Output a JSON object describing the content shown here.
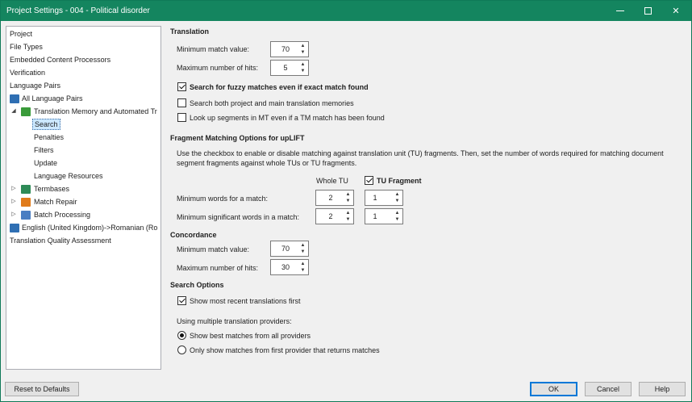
{
  "window": {
    "title": "Project Settings - 004 - Political disorder",
    "min_icon": "minimize-icon",
    "max_icon": "maximize-icon",
    "close_icon": "close-icon",
    "close_glyph": "✕"
  },
  "tree": {
    "project": "Project",
    "file_types": "File Types",
    "embedded": "Embedded Content Processors",
    "verification": "Verification",
    "language_pairs": "Language Pairs",
    "all_language_pairs": "All Language Pairs",
    "tm_automated": "Translation Memory and Automated Tr",
    "search": "Search",
    "penalties": "Penalties",
    "filters": "Filters",
    "update": "Update",
    "language_resources": "Language Resources",
    "termbases": "Termbases",
    "match_repair": "Match Repair",
    "batch_processing": "Batch Processing",
    "english_romanian": "English (United Kingdom)->Romanian (Ro",
    "tqa": "Translation Quality Assessment"
  },
  "translation": {
    "heading": "Translation",
    "min_match_label": "Minimum match value:",
    "min_match_value": "70",
    "max_hits_label": "Maximum number of hits:",
    "max_hits_value": "5",
    "fuzzy_label": "Search for fuzzy matches even if exact match found",
    "fuzzy_checked": true,
    "both_tms_label": "Search both project and main translation memories",
    "both_tms_checked": false,
    "mt_lookup_label": "Look up segments in MT even if a TM match has been found",
    "mt_lookup_checked": false
  },
  "fragment": {
    "heading": "Fragment Matching Options for upLIFT",
    "description": "Use the checkbox to enable or disable matching against translation unit (TU)  fragments. Then, set the number of words required for matching document segment fragments against whole TUs or TU fragments.",
    "whole_tu_header": "Whole TU",
    "tu_fragment_header": "TU Fragment",
    "tu_fragment_checked": true,
    "min_words_label": "Minimum words for a match:",
    "min_words_whole": "2",
    "min_words_fragment": "1",
    "min_sig_words_label": "Minimum significant words in a match:",
    "min_sig_whole": "2",
    "min_sig_fragment": "1"
  },
  "concordance": {
    "heading": "Concordance",
    "min_match_label": "Minimum match value:",
    "min_match_value": "70",
    "max_hits_label": "Maximum number of hits:",
    "max_hits_value": "30"
  },
  "search_options": {
    "heading": "Search Options",
    "recent_label": "Show most recent translations first",
    "recent_checked": true,
    "multi_label": "Using multiple translation providers:",
    "opt_best": "Show best matches from all providers",
    "opt_first": "Only show matches from first provider that returns matches",
    "selected": "best"
  },
  "buttons": {
    "reset": "Reset to Defaults",
    "ok": "OK",
    "cancel": "Cancel",
    "help": "Help"
  },
  "colors": {
    "titlebar": "#14855f",
    "selection": "#cce8ff",
    "default_button_border": "#0078d7"
  }
}
